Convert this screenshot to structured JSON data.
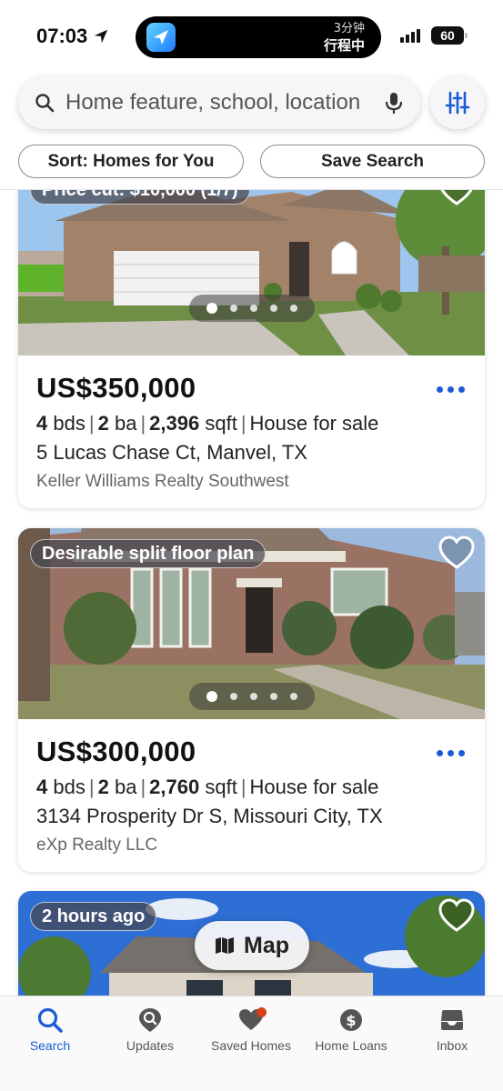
{
  "status_bar": {
    "time": "07:03",
    "island_line1": "3分钟",
    "island_line2": "行程中",
    "battery": "60"
  },
  "search": {
    "placeholder": "Home feature, school, location",
    "mic_icon": "mic-icon",
    "filter_icon": "sliders-icon"
  },
  "controls": {
    "sort_label": "Sort: Homes for You",
    "save_label": "Save Search"
  },
  "listings": [
    {
      "badge": "Price cut: $10,000 (1/7)",
      "price": "US$350,000",
      "beds": "4",
      "beds_unit": "bds",
      "baths": "2",
      "baths_unit": "ba",
      "sqft": "2,396",
      "sqft_unit": "sqft",
      "type": "House for sale",
      "address": "5 Lucas Chase Ct, Manvel, TX",
      "broker": "Keller Williams Realty Southwest",
      "photo_count_dots": 5,
      "active_dot": 1
    },
    {
      "badge": "Desirable split floor plan",
      "price": "US$300,000",
      "beds": "4",
      "beds_unit": "bds",
      "baths": "2",
      "baths_unit": "ba",
      "sqft": "2,760",
      "sqft_unit": "sqft",
      "type": "House for sale",
      "address": "3134 Prosperity Dr S, Missouri City, TX",
      "broker": "eXp Realty LLC",
      "photo_count_dots": 5,
      "active_dot": 1
    },
    {
      "badge": "2 hours ago"
    }
  ],
  "map_button": {
    "label": "Map"
  },
  "tabs": [
    {
      "label": "Search",
      "icon": "search-icon",
      "active": true
    },
    {
      "label": "Updates",
      "icon": "updates-icon",
      "active": false
    },
    {
      "label": "Saved Homes",
      "icon": "heart-icon",
      "active": false,
      "notification": true
    },
    {
      "label": "Home Loans",
      "icon": "dollar-icon",
      "active": false
    },
    {
      "label": "Inbox",
      "icon": "inbox-icon",
      "active": false
    }
  ],
  "colors": {
    "accent": "#1a5bd6",
    "notification": "#d6401a"
  }
}
